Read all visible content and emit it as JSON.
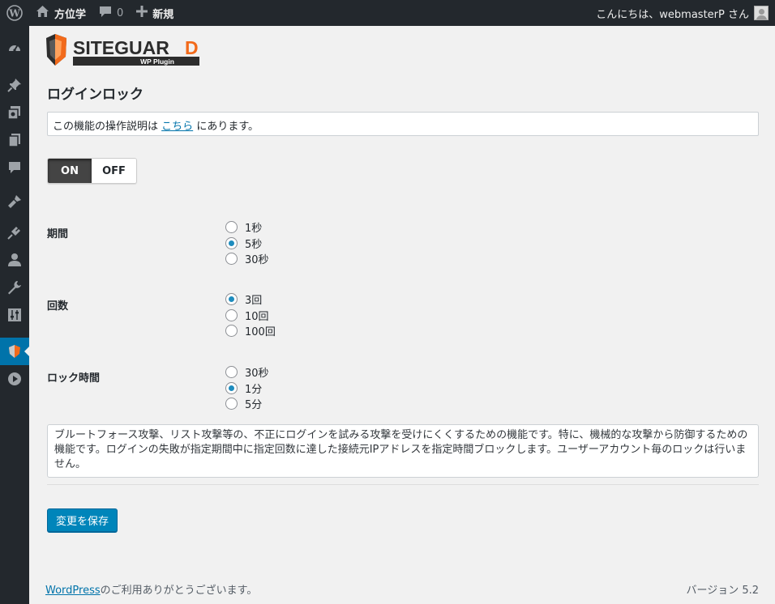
{
  "adminbar": {
    "site_name": "方位学",
    "comments_count": "0",
    "new_label": "新規",
    "greeting": "こんにちは、webmasterP さん"
  },
  "sidebar": {
    "icons": [
      "dashboard-icon",
      "pin-icon",
      "media-icon",
      "pages-icon",
      "comments-icon",
      "appearance-icon",
      "plugins-icon",
      "users-icon",
      "tools-icon",
      "settings-icon",
      "siteguard-icon",
      "play-icon"
    ],
    "current": "siteguard-icon"
  },
  "logo": {
    "text": "SITEGUARD",
    "subtitle": "WP Plugin"
  },
  "page": {
    "title": "ログインロック",
    "notice_prefix": "この機能の操作説明は",
    "notice_link": "こちら",
    "notice_suffix": "にあります。"
  },
  "toggle": {
    "on_label": "ON",
    "off_label": "OFF",
    "state": "ON"
  },
  "fields": {
    "period": {
      "label": "期間",
      "options": [
        {
          "label": "1秒",
          "checked": false
        },
        {
          "label": "5秒",
          "checked": true
        },
        {
          "label": "30秒",
          "checked": false
        }
      ]
    },
    "count": {
      "label": "回数",
      "options": [
        {
          "label": "3回",
          "checked": true
        },
        {
          "label": "10回",
          "checked": false
        },
        {
          "label": "100回",
          "checked": false
        }
      ]
    },
    "lock_time": {
      "label": "ロック時間",
      "options": [
        {
          "label": "30秒",
          "checked": false
        },
        {
          "label": "1分",
          "checked": true
        },
        {
          "label": "5分",
          "checked": false
        }
      ]
    }
  },
  "description": "ブルートフォース攻撃、リスト攻撃等の、不正にログインを試みる攻撃を受けにくくするための機能です。特に、機械的な攻撃から防御するための機能です。ログインの失敗が指定期間中に指定回数に達した接続元IPアドレスを指定時間ブロックします。ユーザーアカウント毎のロックは行いません。",
  "save_label": "変更を保存",
  "footer": {
    "link": "WordPress",
    "text": "のご利用ありがとうございます。",
    "version": "バージョン 5.2"
  },
  "colors": {
    "adminbar_bg": "#23282d",
    "accent": "#0073aa",
    "button": "#0085ba",
    "logo_orange": "#f26a1b"
  }
}
